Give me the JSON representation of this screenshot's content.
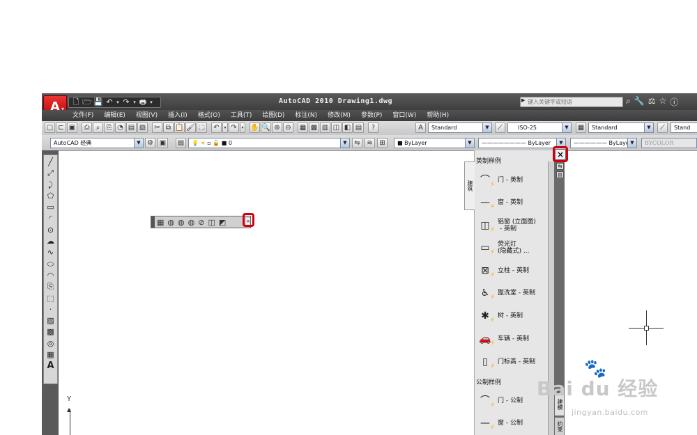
{
  "app": {
    "title": "AutoCAD 2010  Drawing1.dwg",
    "logo_letter": "A",
    "search_placeholder": "键入关键字或短语"
  },
  "quick_access": {
    "icons": [
      "new-icon",
      "open-icon",
      "save-icon",
      "undo-icon",
      "redo-icon",
      "plot-icon"
    ]
  },
  "title_icons": [
    "binoculars-icon",
    "tools-icon",
    "exchange-icon",
    "favorites-icon",
    "help-icon"
  ],
  "menu": {
    "items": [
      "文件(F)",
      "编辑(E)",
      "视图(V)",
      "插入(I)",
      "格式(O)",
      "工具(T)",
      "绘图(D)",
      "标注(N)",
      "修改(M)",
      "参数(P)",
      "窗口(W)",
      "帮助(H)"
    ]
  },
  "toolbar1": {
    "text_style": "Standard",
    "dim_style": "ISO-25",
    "table_style": "Standard",
    "multileader_style": "Stand"
  },
  "toolbar2": {
    "workspace": "AutoCAD 经典",
    "layer": "0",
    "color": "ByLayer",
    "linetype": "ByLayer",
    "lineweight": "ByLayer",
    "plotstyle": "BYCOLOR"
  },
  "palette": {
    "tab_active": "建筑",
    "section_imperial": "英制样例",
    "section_metric": "公制样例",
    "items": [
      {
        "label": "门 - 英制",
        "icon": "door-icon"
      },
      {
        "label": "窗 - 英制",
        "icon": "window-icon"
      },
      {
        "label": "铝窗 (立面图)\n - 英制",
        "icon": "aluminum-window-icon"
      },
      {
        "label": "荧光灯\n(隐藏式) ...",
        "icon": "fluorescent-light-icon"
      },
      {
        "label": "立柱 - 英制",
        "icon": "column-icon"
      },
      {
        "label": "盥洗室 - 英制",
        "icon": "toilet-icon"
      },
      {
        "label": "树 - 英制",
        "icon": "tree-icon"
      },
      {
        "label": "车辆 - 英制",
        "icon": "vehicle-icon"
      },
      {
        "label": "门标高 - 英制",
        "icon": "door-elevation-icon"
      }
    ],
    "metric_items": [
      {
        "label": "门 - 公制",
        "icon": "door-icon"
      },
      {
        "label": "窗 - 公制",
        "icon": "window-icon"
      }
    ],
    "side_tab_1": "建模",
    "side_tab_2": "约束"
  },
  "canvas": {
    "ucs_label": "Y"
  },
  "watermark": {
    "brand": "Bai  du 经验",
    "url": "jingyan.baidu.com"
  },
  "colors": {
    "highlight": "#d00010",
    "titlebar": "#4a4a4a",
    "logo_red": "#cc1111"
  }
}
